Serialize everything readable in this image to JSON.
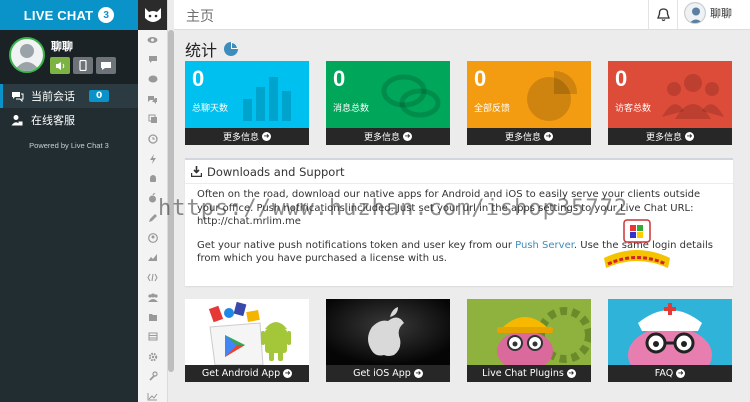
{
  "brand": {
    "title": "LIVE CHAT",
    "version": "3"
  },
  "profile": {
    "name": "聊聊"
  },
  "sidebar": {
    "items": [
      {
        "label": "当前会话",
        "badge": "0",
        "icon": "comments-icon"
      },
      {
        "label": "在线客服",
        "icon": "user-lock-icon"
      }
    ],
    "powered_by": "Powered by Live Chat 3"
  },
  "topbar": {
    "title": "主页",
    "user_name": "聊聊"
  },
  "stats": {
    "title": "统计",
    "cards": [
      {
        "value": "0",
        "label": "总聊天数",
        "more": "更多信息",
        "color": "#00c0ef"
      },
      {
        "value": "0",
        "label": "消息总数",
        "more": "更多信息",
        "color": "#00a65a"
      },
      {
        "value": "0",
        "label": "全部反馈",
        "more": "更多信息",
        "color": "#f39c12"
      },
      {
        "value": "0",
        "label": "访客总数",
        "more": "更多信息",
        "color": "#dd4b39"
      }
    ]
  },
  "downloads": {
    "title": "Downloads and Support",
    "p1": "Often on the road, download our native apps for Android and iOS to easily serve your clients outside your office. Push notifications included. Just set your url in the apps settings to your Live Chat URL:",
    "url": "http://chat.mrlim.me",
    "p2_before": "Get your native push notifications token and user key from our ",
    "p2_link": "Push Server",
    "p2_after": ". Use the same login details from which you have purchased a license with us."
  },
  "watermark": "https://www.huzhan.com/ishop35772",
  "apps": [
    {
      "label": "Get Android App"
    },
    {
      "label": "Get iOS App"
    },
    {
      "label": "Live Chat Plugins"
    },
    {
      "label": "FAQ"
    }
  ],
  "colors": {
    "brand": "#0a93c9",
    "sidebar": "#222d32",
    "link": "#3c8dbc"
  }
}
